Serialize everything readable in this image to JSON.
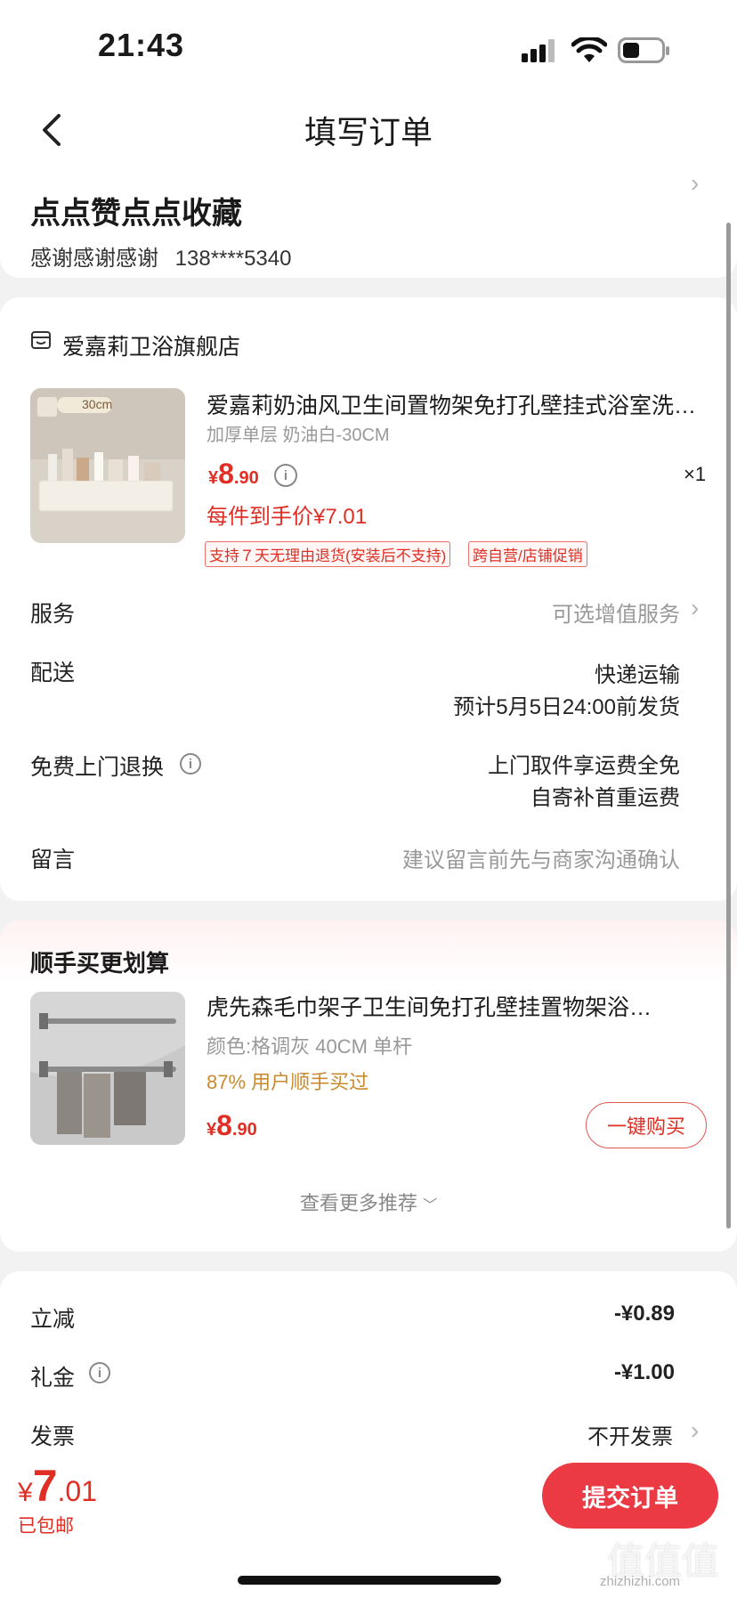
{
  "status_bar": {
    "time": "21:43"
  },
  "nav": {
    "title": "填写订单"
  },
  "address": {
    "name": "点点赞点点收藏",
    "contact": "感谢感谢感谢",
    "phone": "138****5340"
  },
  "store": {
    "name": "爱嘉莉卫浴旗舰店"
  },
  "product": {
    "title": "爱嘉莉奶油风卫生间置物架免打孔壁挂式浴室洗…",
    "spec": "加厚单层 奶油白-30CM",
    "price_symbol": "¥",
    "price_int": "8",
    "price_dec": ".90",
    "quantity": "×1",
    "final_price": "每件到手价¥7.01",
    "thumb_size_label": "30cm",
    "tags": [
      "支持７天无理由退货(安装后不支持)",
      "跨自营/店铺促销"
    ]
  },
  "rows": {
    "service_label": "服务",
    "service_value": "可选增值服务",
    "delivery_label": "配送",
    "delivery_value1": "快递运输",
    "delivery_value2": "预计5月5日24:00前发货",
    "exchange_label": "免费上门退换",
    "exchange_value1": "上门取件享运费全免",
    "exchange_value2": "自寄补首重运费",
    "note_label": "留言",
    "note_value": "建议留言前先与商家沟通确认"
  },
  "recommend": {
    "header": "顺手买更划算",
    "title": "虎先森毛巾架子卫生间免打孔壁挂置物架浴…",
    "spec": "颜色:格调灰 40CM 单杆",
    "bought": "87% 用户顺手买过",
    "price_symbol": "¥",
    "price_int": "8",
    "price_dec": ".90",
    "buy_button": "一键购买",
    "more": "查看更多推荐"
  },
  "summary": {
    "discount_label": "立减",
    "discount_value": "-¥0.89",
    "gift_label": "礼金",
    "gift_value": "-¥1.00",
    "invoice_label": "发票",
    "invoice_value": "不开发票"
  },
  "bottom": {
    "total_symbol": "¥",
    "total_int": "7",
    "total_dec": ".01",
    "shipping": "已包邮",
    "submit": "提交订单"
  },
  "watermark": {
    "text": "值值值",
    "domain": "zhizhizhi.com"
  },
  "colors": {
    "accent": "#e02e24",
    "submit_bg": "#ec3a45"
  },
  "icons": [
    "back-chevron-icon",
    "signal-icon",
    "wifi-icon",
    "battery-icon",
    "store-icon",
    "info-icon",
    "chevron-right-icon",
    "chevron-down-icon"
  ]
}
